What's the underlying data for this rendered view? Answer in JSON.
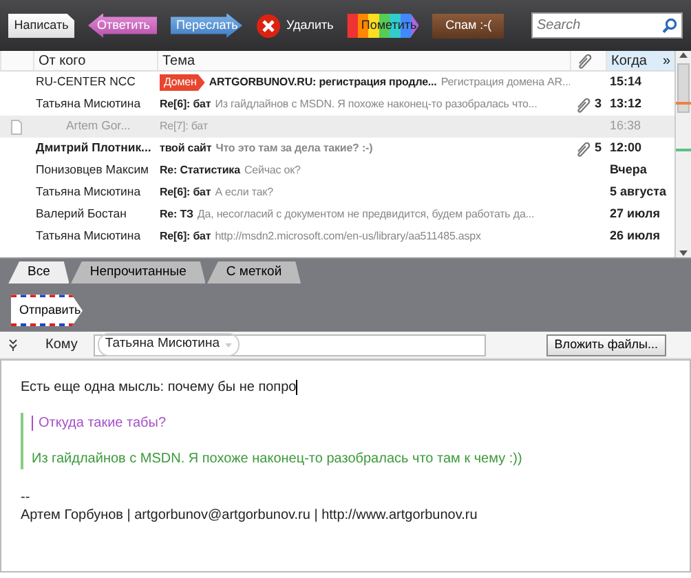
{
  "toolbar": {
    "buttons": [
      {
        "kind": "compose",
        "label": "Написать"
      },
      {
        "kind": "reply",
        "label": "Ответить"
      },
      {
        "kind": "forward",
        "label": "Переслать"
      },
      {
        "kind": "delete",
        "label": "Удалить"
      },
      {
        "kind": "tag",
        "label": "Пометить"
      },
      {
        "kind": "spam",
        "label": "Спам :-("
      }
    ],
    "search": {
      "placeholder": "Search"
    }
  },
  "message_list": {
    "columns": [
      {
        "kind": "text",
        "label": "От кого",
        "sorted": false
      },
      {
        "kind": "text",
        "label": "Тема",
        "sorted": false
      },
      {
        "kind": "attachment",
        "sorted": false
      },
      {
        "kind": "text",
        "label": "Когда",
        "sorted": true
      }
    ],
    "more_label": "»",
    "rows": [
      {
        "kind": "mail",
        "from": "RU-CENTER NCC",
        "badge": "Домен",
        "subject": "ARTGORBUNOV.RU: регистрация продле...",
        "preview": "Регистрация домена AR...",
        "time": "15:14",
        "unread": false
      },
      {
        "kind": "mail",
        "from": "Татьяна Мисютина",
        "subject": "Re[6]: бат",
        "preview": "Из гайдлайнов с MSDN. Я похоже наконец-то разобралась что...",
        "attachments": "3",
        "time": "13:12",
        "unread": false
      },
      {
        "kind": "draft",
        "from": "Artem Gor...",
        "subject": "Re[7]: бат",
        "time": "16:38",
        "unread": false
      },
      {
        "kind": "mail",
        "from": "Дмитрий Плотник...",
        "subject": "твой сайт",
        "preview": "Что это там за дела такие? :-)",
        "attachments": "5",
        "time": "12:00",
        "unread": true
      },
      {
        "kind": "mail",
        "from": "Понизовцев Максим",
        "subject": "Re: Статистика",
        "preview": "Сейчас ок?",
        "time": "Вчера",
        "unread": false
      },
      {
        "kind": "mail",
        "from": "Татьяна Мисютина",
        "subject": "Re[6]: бат",
        "preview": "А если так?",
        "time": "5 августа",
        "unread": false
      },
      {
        "kind": "mail",
        "from": "Валерий Бостан",
        "subject": "Re: ТЗ",
        "preview": "Да, несогласий с документом не предвидится, будем работать да...",
        "time": "27 июля",
        "unread": false
      },
      {
        "kind": "mail",
        "from": "Татьяна Мисютина",
        "subject": "Re[6]: бат",
        "preview": "http://msdn2.microsoft.com/en-us/library/aa511485.aspx",
        "time": "26 июля",
        "unread": false
      }
    ]
  },
  "filter_tabs": [
    {
      "label": "Все",
      "selected": true
    },
    {
      "label": "Непрочитанные",
      "selected": false
    },
    {
      "label": "С меткой",
      "selected": false
    }
  ],
  "compose": {
    "send_label": "Отправить",
    "to_label": "Кому",
    "recipients": [
      "Татьяна Мисютина"
    ],
    "attach_label": "Вложить файлы...",
    "body_text": "Есть еще одна мысль: почему бы не попро",
    "quote_question": "Откуда такие табы?",
    "quote_answer": "Из гайдлайнов с MSDN. Я похоже наконец-то разобралась что там к чему :))",
    "signature_dash": "--",
    "signature": "Артем Горбунов | artgorbunov@artgorbunov.ru | http://www.artgorbunov.ru"
  }
}
